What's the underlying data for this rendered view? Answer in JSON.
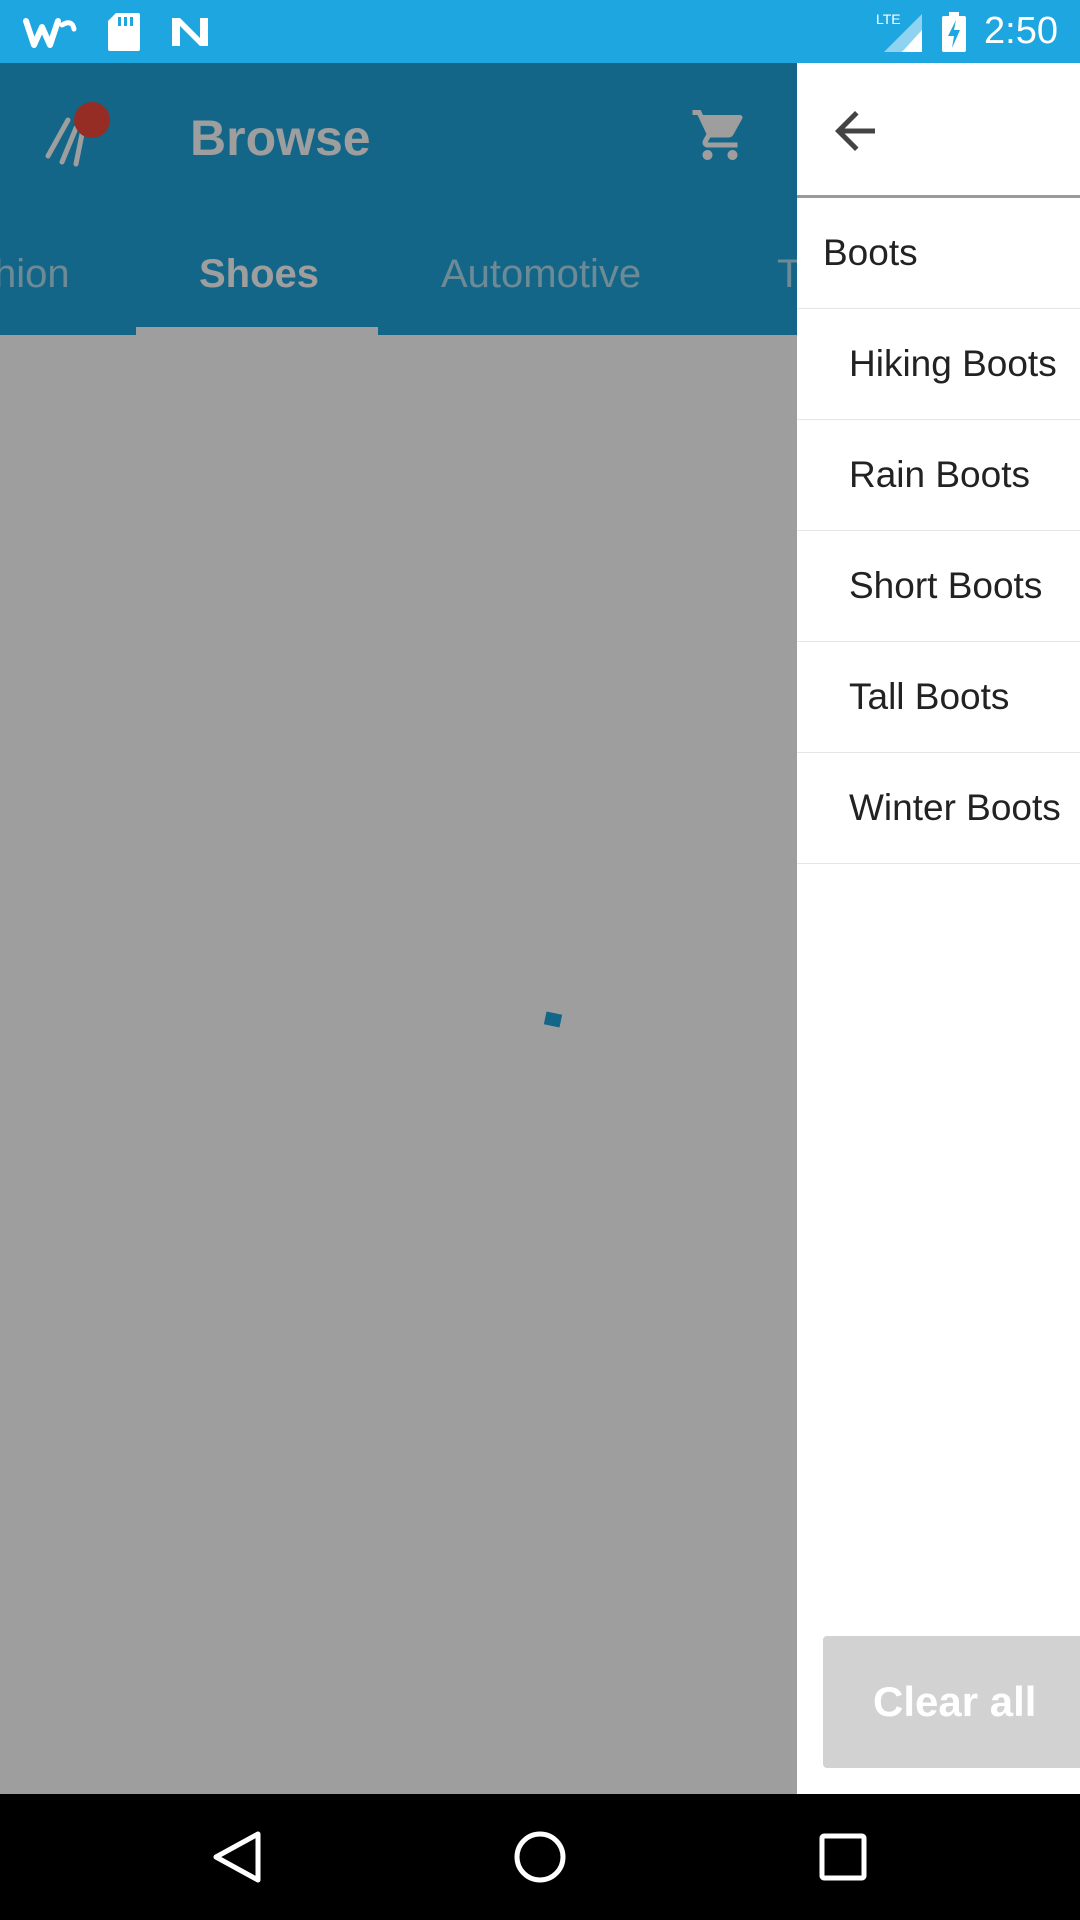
{
  "status_bar": {
    "time": "2:50",
    "network": "LTE",
    "icons": [
      "wish-icon",
      "sd-card-icon",
      "n-icon",
      "signal-icon",
      "battery-charging-icon"
    ]
  },
  "app_bar": {
    "title": "Browse",
    "tabs": [
      {
        "label": "hion"
      },
      {
        "label": "Shoes",
        "active": true
      },
      {
        "label": "Automotive"
      },
      {
        "label": "T"
      }
    ]
  },
  "drawer": {
    "categories": [
      {
        "label": "Boots",
        "level": 0
      },
      {
        "label": "Hiking Boots",
        "level": 1
      },
      {
        "label": "Rain Boots",
        "level": 1
      },
      {
        "label": "Short Boots",
        "level": 1
      },
      {
        "label": "Tall Boots",
        "level": 1
      },
      {
        "label": "Winter Boots",
        "level": 1
      }
    ],
    "clear_all_label": "Clear all"
  },
  "colors": {
    "status_bar": "#1ea6e0",
    "app_bar": "#1fa5dc",
    "scrim": "#9e9e9e",
    "clear_button": "#d2d2d2"
  }
}
